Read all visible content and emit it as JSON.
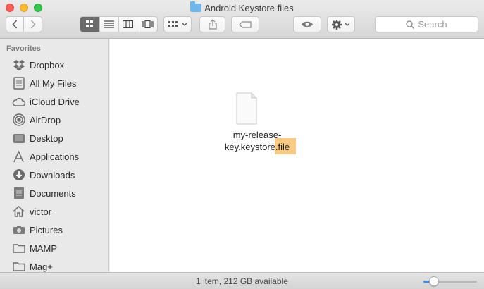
{
  "window": {
    "title": "Android Keystore files"
  },
  "toolbar": {
    "back_icon": "chevron-left-icon",
    "forward_icon": "chevron-right-icon",
    "view_modes": [
      "icon-view-icon",
      "list-view-icon",
      "column-view-icon",
      "cover-flow-icon"
    ],
    "active_view": 0,
    "search": {
      "placeholder": "Search"
    }
  },
  "sidebar": {
    "heading": "Favorites",
    "items": [
      {
        "label": "Dropbox",
        "icon": "dropbox-icon"
      },
      {
        "label": "All My Files",
        "icon": "all-files-icon"
      },
      {
        "label": "iCloud Drive",
        "icon": "cloud-icon"
      },
      {
        "label": "AirDrop",
        "icon": "airdrop-icon"
      },
      {
        "label": "Desktop",
        "icon": "desktop-icon"
      },
      {
        "label": "Applications",
        "icon": "applications-icon"
      },
      {
        "label": "Downloads",
        "icon": "downloads-icon"
      },
      {
        "label": "Documents",
        "icon": "documents-icon"
      },
      {
        "label": "victor",
        "icon": "home-icon"
      },
      {
        "label": "Pictures",
        "icon": "camera-icon"
      },
      {
        "label": "MAMP",
        "icon": "folder-icon"
      },
      {
        "label": "Mag+",
        "icon": "folder-icon"
      }
    ]
  },
  "content": {
    "file": {
      "name_line1": "my-release-",
      "name_line2_main": "key.keystore",
      "name_line2_selected": ".file",
      "icon": "document-icon"
    }
  },
  "status": {
    "text": "1 item, 212 GB available",
    "zoom_level": 0.2
  }
}
